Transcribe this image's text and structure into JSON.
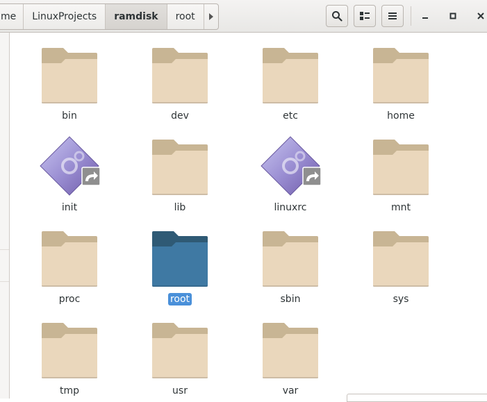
{
  "window": {
    "breadcrumbs": [
      {
        "label": "me"
      },
      {
        "label": "LinuxProjects"
      },
      {
        "label": "ramdisk",
        "active": true
      },
      {
        "label": "root"
      }
    ],
    "icons": {
      "forward": "chevron-right-icon",
      "search": "search-icon",
      "view": "view-options-icon",
      "menu": "menu-icon",
      "minimize": "minimize-icon",
      "maximize": "maximize-icon",
      "close": "close-icon"
    }
  },
  "files": [
    {
      "name": "bin",
      "kind": "folder"
    },
    {
      "name": "dev",
      "kind": "folder"
    },
    {
      "name": "etc",
      "kind": "folder"
    },
    {
      "name": "home",
      "kind": "folder"
    },
    {
      "name": "init",
      "kind": "script-link"
    },
    {
      "name": "lib",
      "kind": "folder"
    },
    {
      "name": "linuxrc",
      "kind": "script-link"
    },
    {
      "name": "mnt",
      "kind": "folder"
    },
    {
      "name": "proc",
      "kind": "folder"
    },
    {
      "name": "root",
      "kind": "folder",
      "selected": true
    },
    {
      "name": "sbin",
      "kind": "folder"
    },
    {
      "name": "sys",
      "kind": "folder"
    },
    {
      "name": "tmp",
      "kind": "folder"
    },
    {
      "name": "usr",
      "kind": "folder"
    },
    {
      "name": "var",
      "kind": "folder"
    }
  ],
  "colors": {
    "folder_body": "#ead7bc",
    "folder_tab": "#c8b594",
    "selected_folder": "#3f79a3",
    "selected_tab": "#2f5a75",
    "selection": "#4a90d9"
  }
}
